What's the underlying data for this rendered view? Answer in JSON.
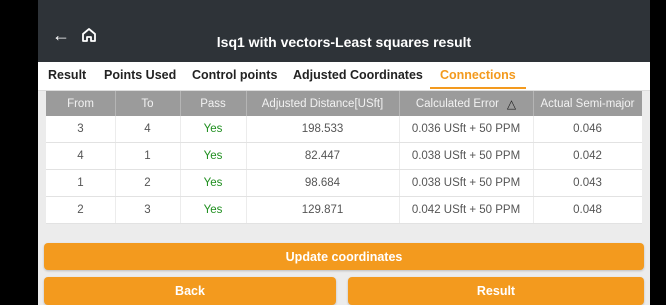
{
  "header": {
    "title": "lsq1 with vectors-Least squares result",
    "back_icon": "arrow-left-icon",
    "home_icon": "home-icon"
  },
  "tabs": [
    {
      "label": "Result"
    },
    {
      "label": "Points Used"
    },
    {
      "label": "Control points"
    },
    {
      "label": "Adjusted Coordinates"
    },
    {
      "label": "Connections",
      "active": true
    }
  ],
  "table": {
    "columns": [
      "From",
      "To",
      "Pass",
      "Adjusted Distance[USft]",
      "Calculated Error",
      "Actual Semi-major"
    ],
    "sort_icon": "delta-icon",
    "rows": [
      {
        "from": "3",
        "to": "4",
        "pass": "Yes",
        "distance": "198.533",
        "error": "0.036 USft + 50 PPM",
        "semi_major": "0.046"
      },
      {
        "from": "4",
        "to": "1",
        "pass": "Yes",
        "distance": "82.447",
        "error": "0.038 USft + 50 PPM",
        "semi_major": "0.042"
      },
      {
        "from": "1",
        "to": "2",
        "pass": "Yes",
        "distance": "98.684",
        "error": "0.038 USft + 50 PPM",
        "semi_major": "0.043"
      },
      {
        "from": "2",
        "to": "3",
        "pass": "Yes",
        "distance": "129.871",
        "error": "0.042 USft + 50 PPM",
        "semi_major": "0.048"
      }
    ]
  },
  "buttons": {
    "update": "Update coordinates",
    "back": "Back",
    "result": "Result"
  },
  "colors": {
    "accent": "#f39a1e",
    "titlebar": "#2e3338",
    "pass_green": "#1f8f1f"
  }
}
